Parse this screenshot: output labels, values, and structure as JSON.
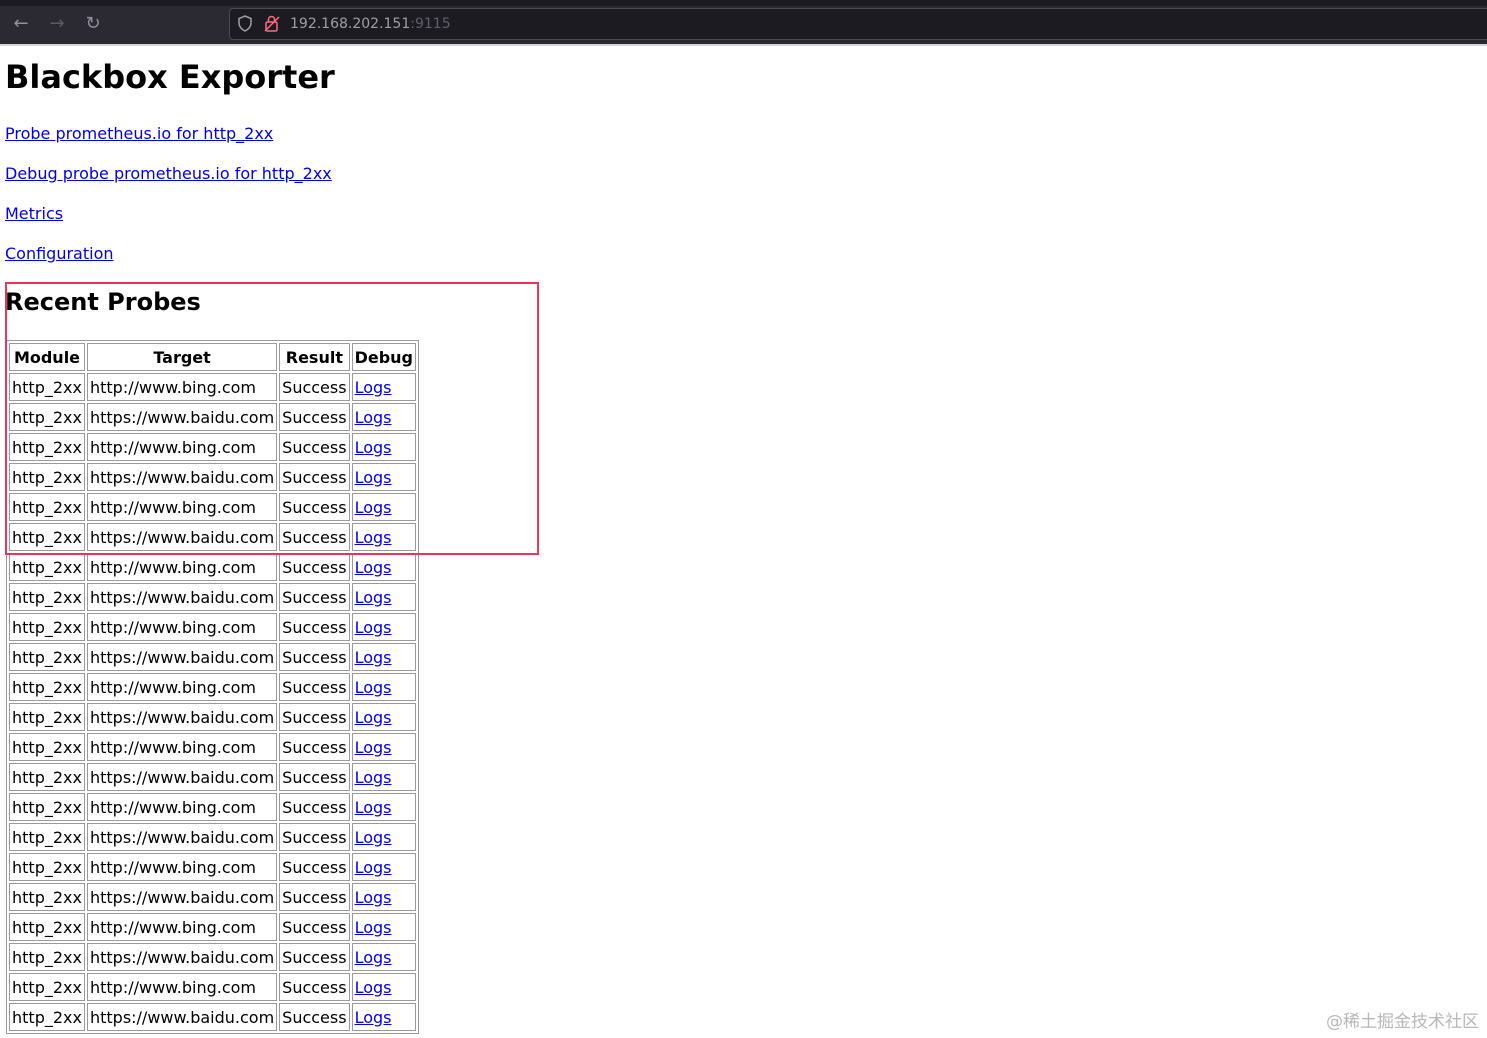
{
  "browser": {
    "url_host": "192.168.202.151",
    "url_port": ":9115"
  },
  "page": {
    "title": "Blackbox Exporter",
    "links": {
      "probe": "Probe prometheus.io for http_2xx",
      "debug_probe": "Debug probe prometheus.io for http_2xx",
      "metrics": "Metrics",
      "configuration": "Configuration"
    },
    "recent_probes": {
      "heading": "Recent Probes",
      "columns": [
        "Module",
        "Target",
        "Result",
        "Debug"
      ],
      "rows": [
        {
          "module": "http_2xx",
          "target": "http://www.bing.com",
          "result": "Success",
          "debug": "Logs"
        },
        {
          "module": "http_2xx",
          "target": "https://www.baidu.com",
          "result": "Success",
          "debug": "Logs"
        },
        {
          "module": "http_2xx",
          "target": "http://www.bing.com",
          "result": "Success",
          "debug": "Logs"
        },
        {
          "module": "http_2xx",
          "target": "https://www.baidu.com",
          "result": "Success",
          "debug": "Logs"
        },
        {
          "module": "http_2xx",
          "target": "http://www.bing.com",
          "result": "Success",
          "debug": "Logs"
        },
        {
          "module": "http_2xx",
          "target": "https://www.baidu.com",
          "result": "Success",
          "debug": "Logs"
        },
        {
          "module": "http_2xx",
          "target": "http://www.bing.com",
          "result": "Success",
          "debug": "Logs"
        },
        {
          "module": "http_2xx",
          "target": "https://www.baidu.com",
          "result": "Success",
          "debug": "Logs"
        },
        {
          "module": "http_2xx",
          "target": "http://www.bing.com",
          "result": "Success",
          "debug": "Logs"
        },
        {
          "module": "http_2xx",
          "target": "https://www.baidu.com",
          "result": "Success",
          "debug": "Logs"
        },
        {
          "module": "http_2xx",
          "target": "http://www.bing.com",
          "result": "Success",
          "debug": "Logs"
        },
        {
          "module": "http_2xx",
          "target": "https://www.baidu.com",
          "result": "Success",
          "debug": "Logs"
        },
        {
          "module": "http_2xx",
          "target": "http://www.bing.com",
          "result": "Success",
          "debug": "Logs"
        },
        {
          "module": "http_2xx",
          "target": "https://www.baidu.com",
          "result": "Success",
          "debug": "Logs"
        },
        {
          "module": "http_2xx",
          "target": "http://www.bing.com",
          "result": "Success",
          "debug": "Logs"
        },
        {
          "module": "http_2xx",
          "target": "https://www.baidu.com",
          "result": "Success",
          "debug": "Logs"
        },
        {
          "module": "http_2xx",
          "target": "http://www.bing.com",
          "result": "Success",
          "debug": "Logs"
        },
        {
          "module": "http_2xx",
          "target": "https://www.baidu.com",
          "result": "Success",
          "debug": "Logs"
        },
        {
          "module": "http_2xx",
          "target": "http://www.bing.com",
          "result": "Success",
          "debug": "Logs"
        },
        {
          "module": "http_2xx",
          "target": "https://www.baidu.com",
          "result": "Success",
          "debug": "Logs"
        },
        {
          "module": "http_2xx",
          "target": "http://www.bing.com",
          "result": "Success",
          "debug": "Logs"
        },
        {
          "module": "http_2xx",
          "target": "https://www.baidu.com",
          "result": "Success",
          "debug": "Logs"
        }
      ]
    }
  },
  "annotation": {
    "highlight_color": "#e8345a"
  },
  "watermark": "@稀土掘金技术社区",
  "colors": {
    "link": "#0000ee",
    "toolbar_bg": "#2b2a33",
    "urlbar_bg": "#1c1b22"
  },
  "icons": {
    "back": "arrow-left-icon",
    "forward": "arrow-right-icon",
    "reload": "reload-icon",
    "shield": "shield-icon",
    "lock": "lock-warning-icon"
  }
}
